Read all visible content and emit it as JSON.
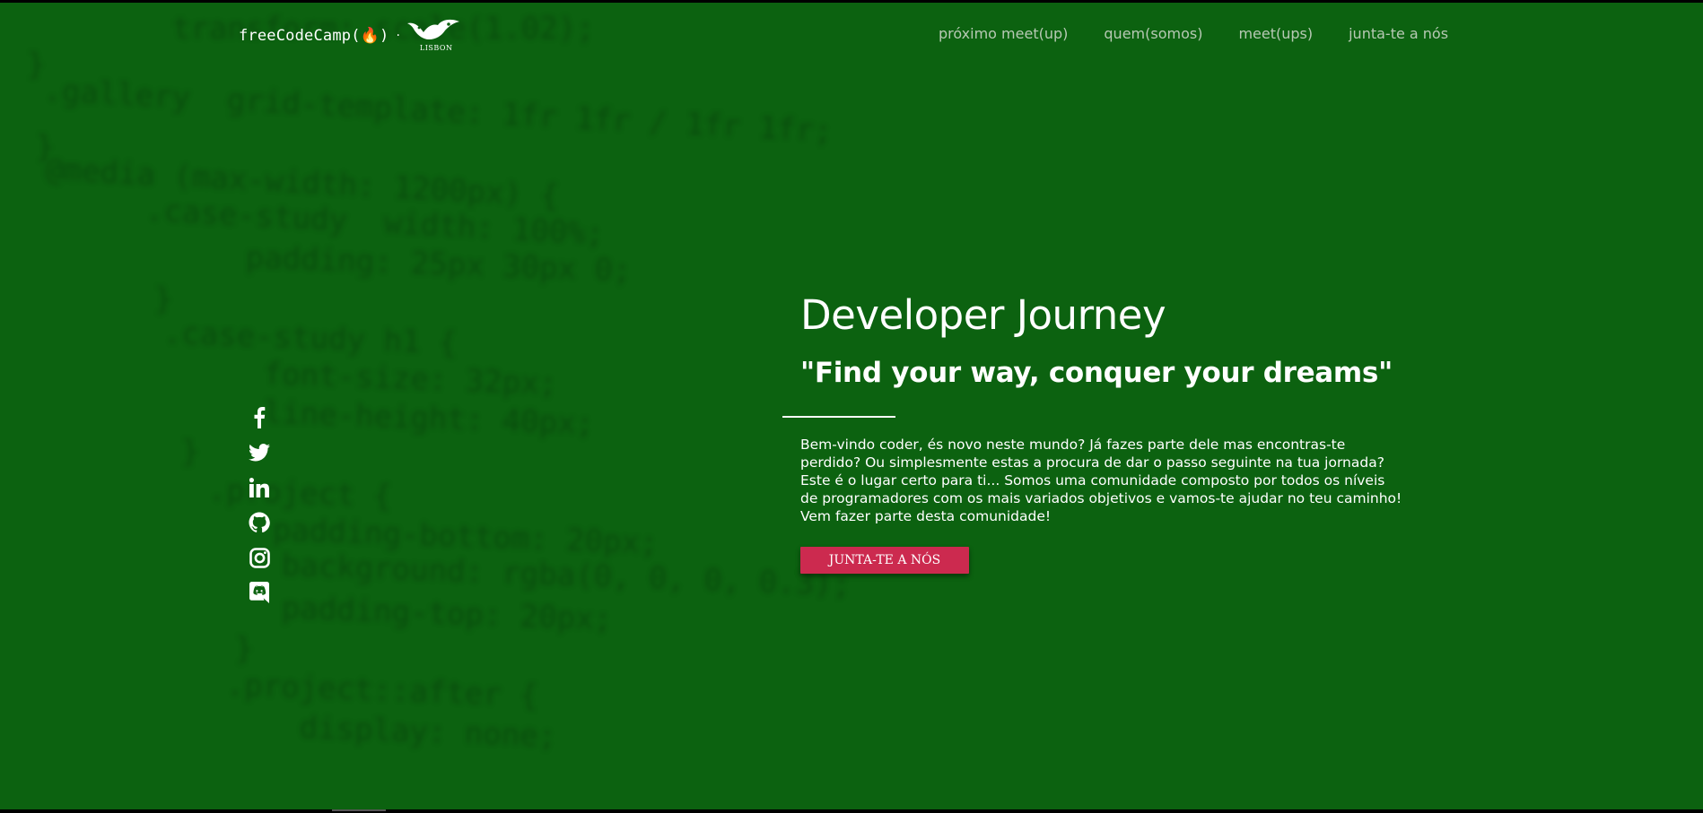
{
  "brand": {
    "name": "freeCodeCamp(🔥)",
    "separator": "·",
    "city": "LISBON"
  },
  "nav": {
    "items": [
      {
        "label": "próximo meet(up)"
      },
      {
        "label": "quem(somos)"
      },
      {
        "label": "meet(ups)"
      },
      {
        "label": "junta-te a nós"
      }
    ]
  },
  "social": {
    "icons": [
      "facebook-icon",
      "twitter-icon",
      "linkedin-icon",
      "github-icon",
      "instagram-icon",
      "discord-icon"
    ]
  },
  "hero": {
    "title": "Developer Journey",
    "subtitle": "\"Find your way, conquer your dreams\"",
    "text": "Bem-vindo coder, és novo neste mundo? Já fazes parte dele mas encontras-te perdido? Ou simplesmente estas a procura de dar o passo seguinte na tua jornada? Este é o lugar certo para ti... Somos uma comunidade composto por todos os níveis de programadores com os mais variados objetivos e vamos-te ajudar no teu caminho! Vem fazer parte desta comunidade!",
    "cta_label": "JUNTA-TE A NÓS"
  },
  "background_code": [
    "    transform: scale(1.02);",
    "}",
    ".gallery  grid-template: 1fr 1fr / 1fr 1fr;",
    "}",
    "@media (max-width: 1200px) {",
    "    .case-study  width: 100%;",
    "        padding: 25px 30px 0;",
    "    }",
    "    .case-study h1 {",
    "        font-size: 32px;",
    "        line-height: 40px;",
    "    }",
    "    .project {",
    "        padding-bottom: 20px;",
    "        background: rgba(0, 0, 0, 0.3);",
    "        padding-top: 20px;",
    "    }",
    "    .project::after {",
    "        display: none;"
  ],
  "colors": {
    "background": "#0c6210",
    "cta": "#cc2a4f",
    "nav_text": "#b7c9b4"
  }
}
